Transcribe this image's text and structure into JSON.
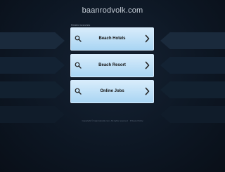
{
  "header": {
    "domain": "baanrodvolk.com"
  },
  "related": {
    "label": "Related searches",
    "links": [
      {
        "label": "Beach Hotels",
        "icon": "search-icon",
        "chevron": "chevron-right-icon"
      },
      {
        "label": "Beach Resort",
        "icon": "search-icon",
        "chevron": "chevron-right-icon"
      },
      {
        "label": "Online Jobs",
        "icon": "search-icon",
        "chevron": "chevron-right-icon"
      }
    ]
  },
  "footer": {
    "copyright": "Copyright © baanrodvolk.com. All rights reserved.",
    "privacy": "Privacy Policy"
  },
  "colors": {
    "background": "#0d1724",
    "card_top": "#d8ecfb",
    "card_bottom": "#a9d5f3",
    "card_text": "#111111"
  }
}
